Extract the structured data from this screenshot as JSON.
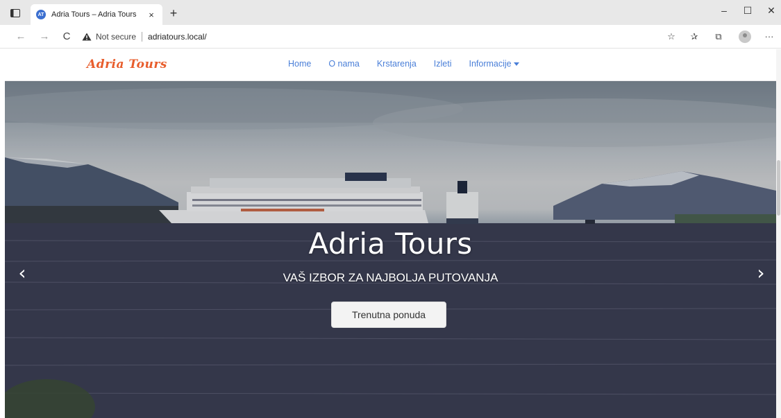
{
  "browser": {
    "tab_title": "Adria Tours – Adria Tours",
    "tab_close": "×",
    "new_tab": "+",
    "window": {
      "minimize": "–",
      "maximize": "☐",
      "close": "✕"
    },
    "nav": {
      "back": "←",
      "forward": "→",
      "reload": "C"
    },
    "security_label": "Not secure",
    "url": "adriatours.local/",
    "icons": [
      "favorites-add-icon",
      "favorites-icon",
      "collections-icon",
      "profile-icon",
      "more-icon"
    ],
    "more": "···"
  },
  "site": {
    "logo": "Adria Tours",
    "menu": [
      {
        "label": "Home"
      },
      {
        "label": "O nama"
      },
      {
        "label": "Krstarenja"
      },
      {
        "label": "Izleti"
      },
      {
        "label": "Informacije"
      }
    ],
    "brand_color": "#e85d2c",
    "link_color": "#4a7fd8"
  },
  "hero": {
    "title": "Adria Tours",
    "subtitle": "VAŠ IZBOR ZA NAJBOLJA PUTOVANJA",
    "button": "Trenutna ponuda",
    "prev": "‹",
    "next": "›"
  }
}
